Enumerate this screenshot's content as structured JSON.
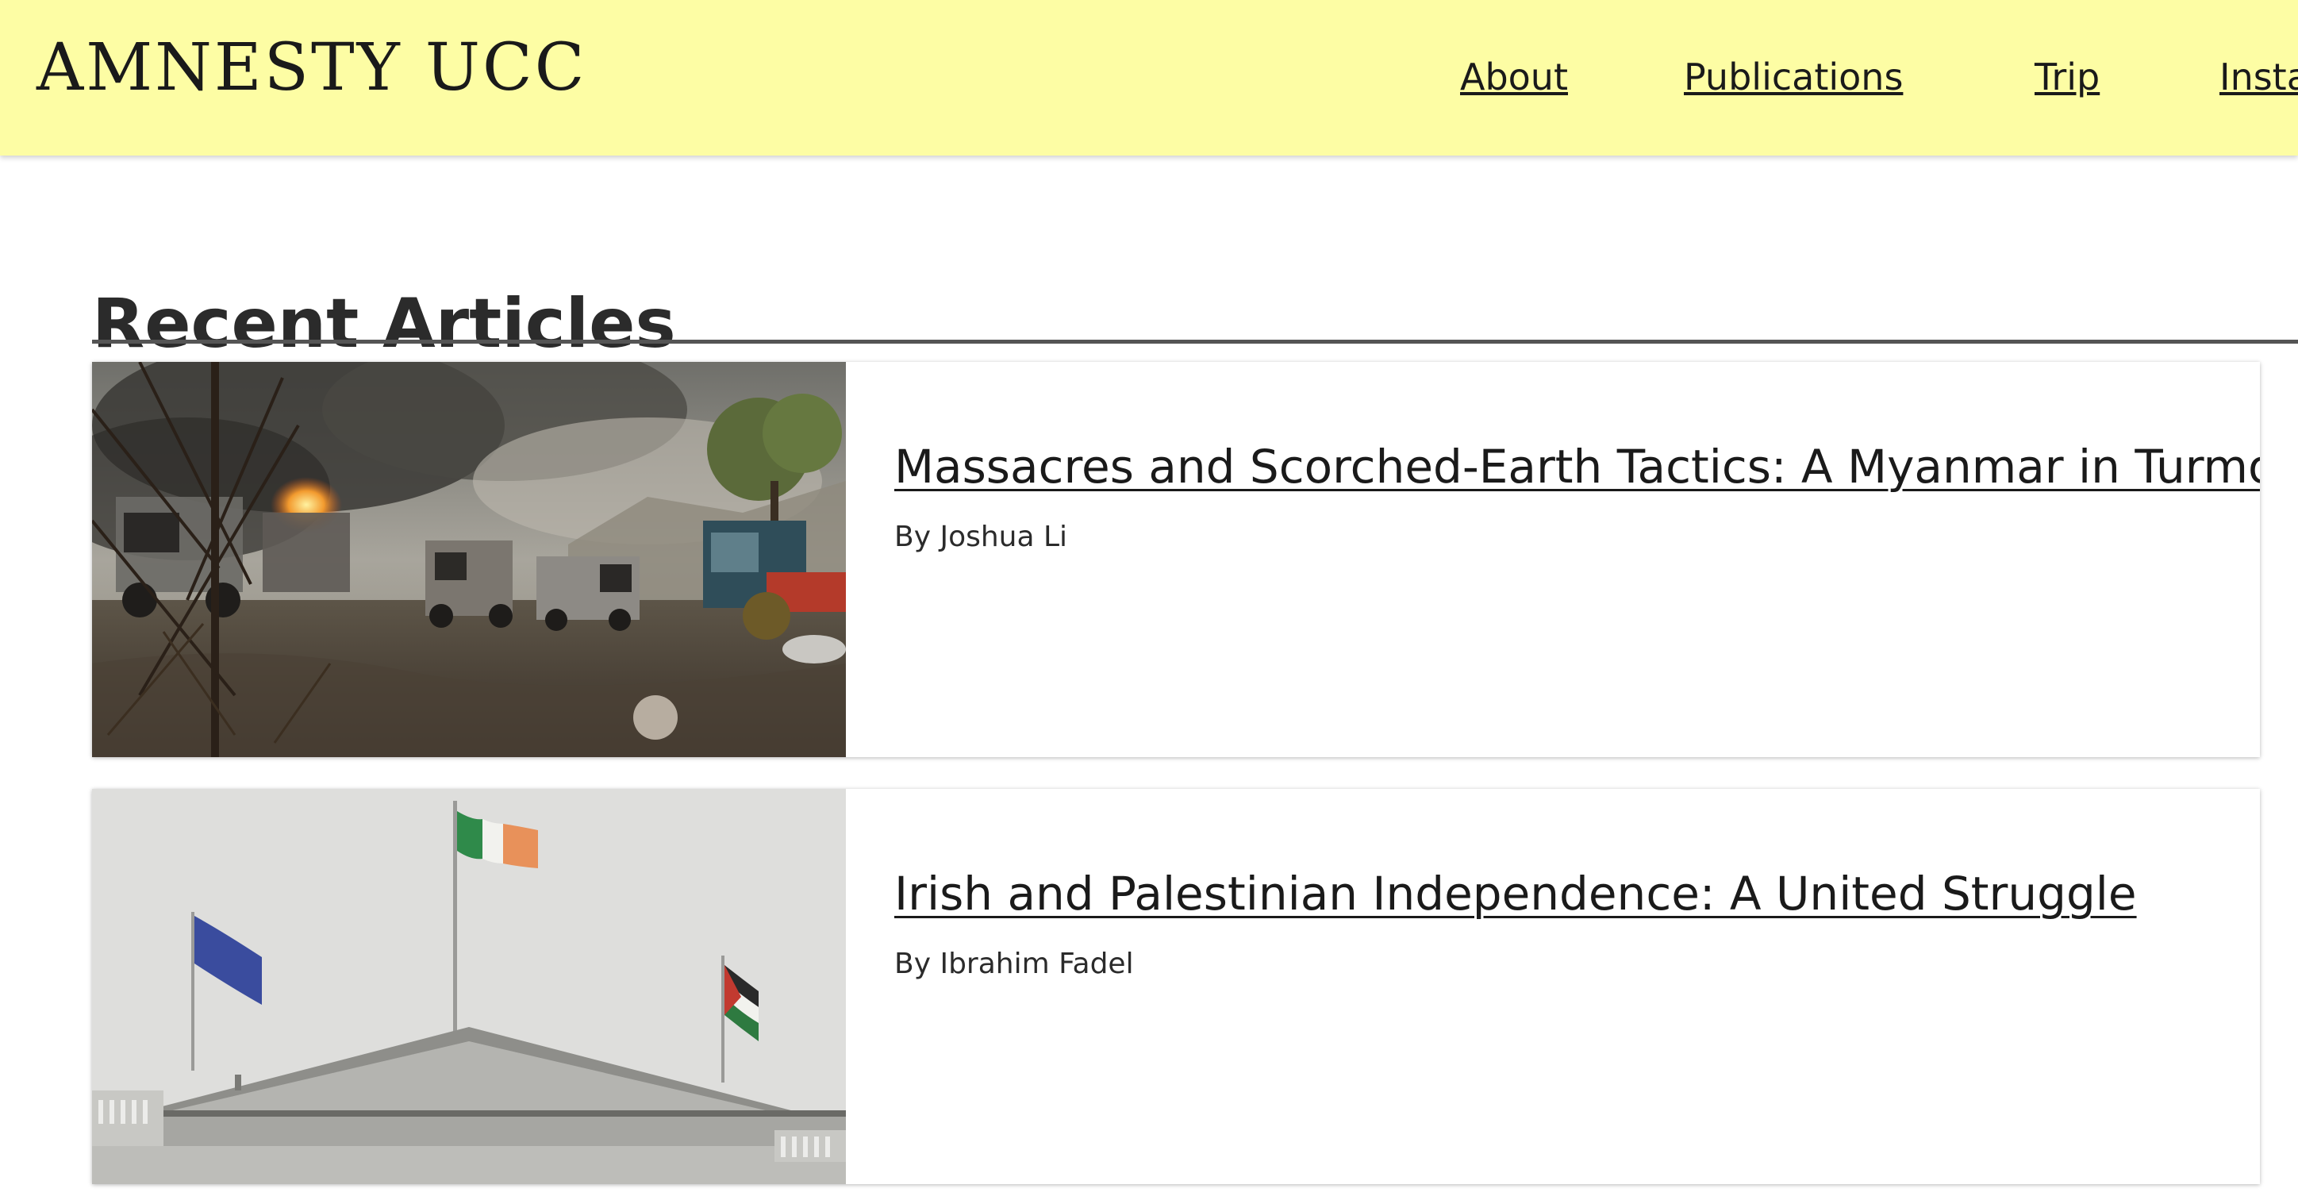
{
  "header": {
    "brand": "AMNESTY UCC",
    "background_color": "#fdfda4",
    "nav": [
      {
        "label": "About"
      },
      {
        "label": "Publications"
      },
      {
        "label": "Trip"
      },
      {
        "label": "Insta"
      }
    ]
  },
  "main": {
    "section_title": "Recent Articles",
    "articles": [
      {
        "title": "Massacres and Scorched-Earth Tactics: A Myanmar in Turmoil",
        "author": "By Joshua Li",
        "image_icon": "burned-vehicles-photo"
      },
      {
        "title": "Irish and Palestinian Independence: A United Struggle",
        "author": "By Ibrahim Fadel",
        "image_icon": "flags-on-building-photo"
      }
    ]
  }
}
